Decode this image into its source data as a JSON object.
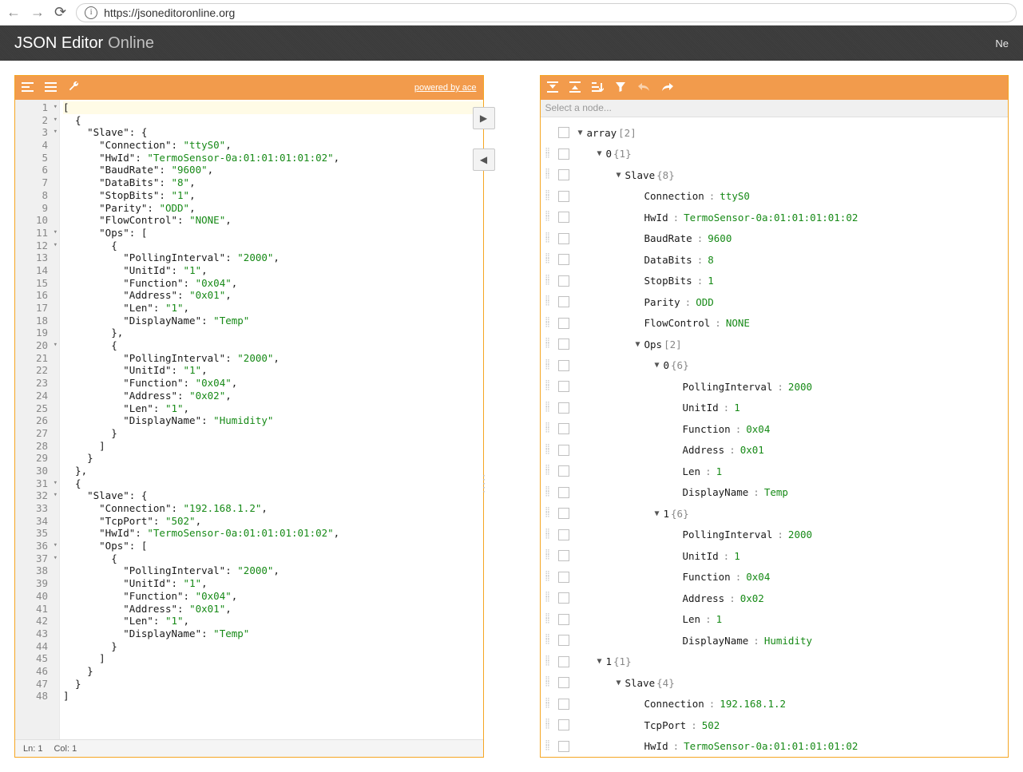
{
  "browser": {
    "url": "https://jsoneditoronline.org",
    "nav_right_label": "Ne"
  },
  "brand": {
    "name": "JSON Editor",
    "suffix": "Online"
  },
  "leftPanel": {
    "powered": "powered by ace",
    "status": {
      "ln": "Ln: 1",
      "col": "Col: 1"
    },
    "gutter": [
      {
        "n": "1",
        "f": true
      },
      {
        "n": "2",
        "f": true
      },
      {
        "n": "3",
        "f": true
      },
      {
        "n": "4"
      },
      {
        "n": "5"
      },
      {
        "n": "6"
      },
      {
        "n": "7"
      },
      {
        "n": "8"
      },
      {
        "n": "9"
      },
      {
        "n": "10"
      },
      {
        "n": "11",
        "f": true
      },
      {
        "n": "12",
        "f": true
      },
      {
        "n": "13"
      },
      {
        "n": "14"
      },
      {
        "n": "15"
      },
      {
        "n": "16"
      },
      {
        "n": "17"
      },
      {
        "n": "18"
      },
      {
        "n": "19"
      },
      {
        "n": "20",
        "f": true
      },
      {
        "n": "21"
      },
      {
        "n": "22"
      },
      {
        "n": "23"
      },
      {
        "n": "24"
      },
      {
        "n": "25"
      },
      {
        "n": "26"
      },
      {
        "n": "27"
      },
      {
        "n": "28"
      },
      {
        "n": "29"
      },
      {
        "n": "30"
      },
      {
        "n": "31",
        "f": true
      },
      {
        "n": "32",
        "f": true
      },
      {
        "n": "33"
      },
      {
        "n": "34"
      },
      {
        "n": "35"
      },
      {
        "n": "36",
        "f": true
      },
      {
        "n": "37",
        "f": true
      },
      {
        "n": "38"
      },
      {
        "n": "39"
      },
      {
        "n": "40"
      },
      {
        "n": "41"
      },
      {
        "n": "42"
      },
      {
        "n": "43"
      },
      {
        "n": "44"
      },
      {
        "n": "45"
      },
      {
        "n": "46"
      },
      {
        "n": "47"
      },
      {
        "n": "48"
      }
    ],
    "code": [
      {
        "hl": true,
        "seg": [
          {
            "t": "[",
            "c": "pun"
          }
        ]
      },
      {
        "seg": [
          {
            "t": "  {",
            "c": "pun"
          }
        ]
      },
      {
        "seg": [
          {
            "t": "    ",
            "c": "pun"
          },
          {
            "t": "\"Slave\"",
            "c": "key"
          },
          {
            "t": ": {",
            "c": "pun"
          }
        ]
      },
      {
        "seg": [
          {
            "t": "      ",
            "c": "pun"
          },
          {
            "t": "\"Connection\"",
            "c": "key"
          },
          {
            "t": ": ",
            "c": "pun"
          },
          {
            "t": "\"ttyS0\"",
            "c": "str"
          },
          {
            "t": ",",
            "c": "pun"
          }
        ]
      },
      {
        "seg": [
          {
            "t": "      ",
            "c": "pun"
          },
          {
            "t": "\"HwId\"",
            "c": "key"
          },
          {
            "t": ": ",
            "c": "pun"
          },
          {
            "t": "\"TermoSensor-0a:01:01:01:01:02\"",
            "c": "str"
          },
          {
            "t": ",",
            "c": "pun"
          }
        ]
      },
      {
        "seg": [
          {
            "t": "      ",
            "c": "pun"
          },
          {
            "t": "\"BaudRate\"",
            "c": "key"
          },
          {
            "t": ": ",
            "c": "pun"
          },
          {
            "t": "\"9600\"",
            "c": "str"
          },
          {
            "t": ",",
            "c": "pun"
          }
        ]
      },
      {
        "seg": [
          {
            "t": "      ",
            "c": "pun"
          },
          {
            "t": "\"DataBits\"",
            "c": "key"
          },
          {
            "t": ": ",
            "c": "pun"
          },
          {
            "t": "\"8\"",
            "c": "str"
          },
          {
            "t": ",",
            "c": "pun"
          }
        ]
      },
      {
        "seg": [
          {
            "t": "      ",
            "c": "pun"
          },
          {
            "t": "\"StopBits\"",
            "c": "key"
          },
          {
            "t": ": ",
            "c": "pun"
          },
          {
            "t": "\"1\"",
            "c": "str"
          },
          {
            "t": ",",
            "c": "pun"
          }
        ]
      },
      {
        "seg": [
          {
            "t": "      ",
            "c": "pun"
          },
          {
            "t": "\"Parity\"",
            "c": "key"
          },
          {
            "t": ": ",
            "c": "pun"
          },
          {
            "t": "\"ODD\"",
            "c": "str"
          },
          {
            "t": ",",
            "c": "pun"
          }
        ]
      },
      {
        "seg": [
          {
            "t": "      ",
            "c": "pun"
          },
          {
            "t": "\"FlowControl\"",
            "c": "key"
          },
          {
            "t": ": ",
            "c": "pun"
          },
          {
            "t": "\"NONE\"",
            "c": "str"
          },
          {
            "t": ",",
            "c": "pun"
          }
        ]
      },
      {
        "seg": [
          {
            "t": "      ",
            "c": "pun"
          },
          {
            "t": "\"Ops\"",
            "c": "key"
          },
          {
            "t": ": [",
            "c": "pun"
          }
        ]
      },
      {
        "seg": [
          {
            "t": "        {",
            "c": "pun"
          }
        ]
      },
      {
        "seg": [
          {
            "t": "          ",
            "c": "pun"
          },
          {
            "t": "\"PollingInterval\"",
            "c": "key"
          },
          {
            "t": ": ",
            "c": "pun"
          },
          {
            "t": "\"2000\"",
            "c": "str"
          },
          {
            "t": ",",
            "c": "pun"
          }
        ]
      },
      {
        "seg": [
          {
            "t": "          ",
            "c": "pun"
          },
          {
            "t": "\"UnitId\"",
            "c": "key"
          },
          {
            "t": ": ",
            "c": "pun"
          },
          {
            "t": "\"1\"",
            "c": "str"
          },
          {
            "t": ",",
            "c": "pun"
          }
        ]
      },
      {
        "seg": [
          {
            "t": "          ",
            "c": "pun"
          },
          {
            "t": "\"Function\"",
            "c": "key"
          },
          {
            "t": ": ",
            "c": "pun"
          },
          {
            "t": "\"0x04\"",
            "c": "str"
          },
          {
            "t": ",",
            "c": "pun"
          }
        ]
      },
      {
        "seg": [
          {
            "t": "          ",
            "c": "pun"
          },
          {
            "t": "\"Address\"",
            "c": "key"
          },
          {
            "t": ": ",
            "c": "pun"
          },
          {
            "t": "\"0x01\"",
            "c": "str"
          },
          {
            "t": ",",
            "c": "pun"
          }
        ]
      },
      {
        "seg": [
          {
            "t": "          ",
            "c": "pun"
          },
          {
            "t": "\"Len\"",
            "c": "key"
          },
          {
            "t": ": ",
            "c": "pun"
          },
          {
            "t": "\"1\"",
            "c": "str"
          },
          {
            "t": ",",
            "c": "pun"
          }
        ]
      },
      {
        "seg": [
          {
            "t": "          ",
            "c": "pun"
          },
          {
            "t": "\"DisplayName\"",
            "c": "key"
          },
          {
            "t": ": ",
            "c": "pun"
          },
          {
            "t": "\"Temp\"",
            "c": "str"
          }
        ]
      },
      {
        "seg": [
          {
            "t": "        },",
            "c": "pun"
          }
        ]
      },
      {
        "seg": [
          {
            "t": "        {",
            "c": "pun"
          }
        ]
      },
      {
        "seg": [
          {
            "t": "          ",
            "c": "pun"
          },
          {
            "t": "\"PollingInterval\"",
            "c": "key"
          },
          {
            "t": ": ",
            "c": "pun"
          },
          {
            "t": "\"2000\"",
            "c": "str"
          },
          {
            "t": ",",
            "c": "pun"
          }
        ]
      },
      {
        "seg": [
          {
            "t": "          ",
            "c": "pun"
          },
          {
            "t": "\"UnitId\"",
            "c": "key"
          },
          {
            "t": ": ",
            "c": "pun"
          },
          {
            "t": "\"1\"",
            "c": "str"
          },
          {
            "t": ",",
            "c": "pun"
          }
        ]
      },
      {
        "seg": [
          {
            "t": "          ",
            "c": "pun"
          },
          {
            "t": "\"Function\"",
            "c": "key"
          },
          {
            "t": ": ",
            "c": "pun"
          },
          {
            "t": "\"0x04\"",
            "c": "str"
          },
          {
            "t": ",",
            "c": "pun"
          }
        ]
      },
      {
        "seg": [
          {
            "t": "          ",
            "c": "pun"
          },
          {
            "t": "\"Address\"",
            "c": "key"
          },
          {
            "t": ": ",
            "c": "pun"
          },
          {
            "t": "\"0x02\"",
            "c": "str"
          },
          {
            "t": ",",
            "c": "pun"
          }
        ]
      },
      {
        "seg": [
          {
            "t": "          ",
            "c": "pun"
          },
          {
            "t": "\"Len\"",
            "c": "key"
          },
          {
            "t": ": ",
            "c": "pun"
          },
          {
            "t": "\"1\"",
            "c": "str"
          },
          {
            "t": ",",
            "c": "pun"
          }
        ]
      },
      {
        "seg": [
          {
            "t": "          ",
            "c": "pun"
          },
          {
            "t": "\"DisplayName\"",
            "c": "key"
          },
          {
            "t": ": ",
            "c": "pun"
          },
          {
            "t": "\"Humidity\"",
            "c": "str"
          }
        ]
      },
      {
        "seg": [
          {
            "t": "        }",
            "c": "pun"
          }
        ]
      },
      {
        "seg": [
          {
            "t": "      ]",
            "c": "pun"
          }
        ]
      },
      {
        "seg": [
          {
            "t": "    }",
            "c": "pun"
          }
        ]
      },
      {
        "seg": [
          {
            "t": "  },",
            "c": "pun"
          }
        ]
      },
      {
        "seg": [
          {
            "t": "  {",
            "c": "pun"
          }
        ]
      },
      {
        "seg": [
          {
            "t": "    ",
            "c": "pun"
          },
          {
            "t": "\"Slave\"",
            "c": "key"
          },
          {
            "t": ": {",
            "c": "pun"
          }
        ]
      },
      {
        "seg": [
          {
            "t": "      ",
            "c": "pun"
          },
          {
            "t": "\"Connection\"",
            "c": "key"
          },
          {
            "t": ": ",
            "c": "pun"
          },
          {
            "t": "\"192.168.1.2\"",
            "c": "str"
          },
          {
            "t": ",",
            "c": "pun"
          }
        ]
      },
      {
        "seg": [
          {
            "t": "      ",
            "c": "pun"
          },
          {
            "t": "\"TcpPort\"",
            "c": "key"
          },
          {
            "t": ": ",
            "c": "pun"
          },
          {
            "t": "\"502\"",
            "c": "str"
          },
          {
            "t": ",",
            "c": "pun"
          }
        ]
      },
      {
        "seg": [
          {
            "t": "      ",
            "c": "pun"
          },
          {
            "t": "\"HwId\"",
            "c": "key"
          },
          {
            "t": ": ",
            "c": "pun"
          },
          {
            "t": "\"TermoSensor-0a:01:01:01:01:02\"",
            "c": "str"
          },
          {
            "t": ",",
            "c": "pun"
          }
        ]
      },
      {
        "seg": [
          {
            "t": "      ",
            "c": "pun"
          },
          {
            "t": "\"Ops\"",
            "c": "key"
          },
          {
            "t": ": [",
            "c": "pun"
          }
        ]
      },
      {
        "seg": [
          {
            "t": "        {",
            "c": "pun"
          }
        ]
      },
      {
        "seg": [
          {
            "t": "          ",
            "c": "pun"
          },
          {
            "t": "\"PollingInterval\"",
            "c": "key"
          },
          {
            "t": ": ",
            "c": "pun"
          },
          {
            "t": "\"2000\"",
            "c": "str"
          },
          {
            "t": ",",
            "c": "pun"
          }
        ]
      },
      {
        "seg": [
          {
            "t": "          ",
            "c": "pun"
          },
          {
            "t": "\"UnitId\"",
            "c": "key"
          },
          {
            "t": ": ",
            "c": "pun"
          },
          {
            "t": "\"1\"",
            "c": "str"
          },
          {
            "t": ",",
            "c": "pun"
          }
        ]
      },
      {
        "seg": [
          {
            "t": "          ",
            "c": "pun"
          },
          {
            "t": "\"Function\"",
            "c": "key"
          },
          {
            "t": ": ",
            "c": "pun"
          },
          {
            "t": "\"0x04\"",
            "c": "str"
          },
          {
            "t": ",",
            "c": "pun"
          }
        ]
      },
      {
        "seg": [
          {
            "t": "          ",
            "c": "pun"
          },
          {
            "t": "\"Address\"",
            "c": "key"
          },
          {
            "t": ": ",
            "c": "pun"
          },
          {
            "t": "\"0x01\"",
            "c": "str"
          },
          {
            "t": ",",
            "c": "pun"
          }
        ]
      },
      {
        "seg": [
          {
            "t": "          ",
            "c": "pun"
          },
          {
            "t": "\"Len\"",
            "c": "key"
          },
          {
            "t": ": ",
            "c": "pun"
          },
          {
            "t": "\"1\"",
            "c": "str"
          },
          {
            "t": ",",
            "c": "pun"
          }
        ]
      },
      {
        "seg": [
          {
            "t": "          ",
            "c": "pun"
          },
          {
            "t": "\"DisplayName\"",
            "c": "key"
          },
          {
            "t": ": ",
            "c": "pun"
          },
          {
            "t": "\"Temp\"",
            "c": "str"
          }
        ]
      },
      {
        "seg": [
          {
            "t": "        }",
            "c": "pun"
          }
        ]
      },
      {
        "seg": [
          {
            "t": "      ]",
            "c": "pun"
          }
        ]
      },
      {
        "seg": [
          {
            "t": "    }",
            "c": "pun"
          }
        ]
      },
      {
        "seg": [
          {
            "t": "  }",
            "c": "pun"
          }
        ]
      },
      {
        "seg": [
          {
            "t": "]",
            "c": "pun"
          }
        ]
      }
    ]
  },
  "rightPanel": {
    "placeholder": "Select a node...",
    "rows": [
      {
        "d": 0,
        "caret": "▼",
        "key": "array",
        "info": "[2]",
        "noHandle": true
      },
      {
        "d": 1,
        "caret": "▼",
        "key": "0",
        "info": "{1}"
      },
      {
        "d": 2,
        "caret": "▼",
        "key": "Slave",
        "info": "{8}"
      },
      {
        "d": 3,
        "caret": "",
        "key": "Connection",
        "val": "ttyS0"
      },
      {
        "d": 3,
        "caret": "",
        "key": "HwId",
        "val": "TermoSensor-0a:01:01:01:01:02"
      },
      {
        "d": 3,
        "caret": "",
        "key": "BaudRate",
        "val": "9600"
      },
      {
        "d": 3,
        "caret": "",
        "key": "DataBits",
        "val": "8"
      },
      {
        "d": 3,
        "caret": "",
        "key": "StopBits",
        "val": "1"
      },
      {
        "d": 3,
        "caret": "",
        "key": "Parity",
        "val": "ODD"
      },
      {
        "d": 3,
        "caret": "",
        "key": "FlowControl",
        "val": "NONE"
      },
      {
        "d": 3,
        "caret": "▼",
        "key": "Ops",
        "info": "[2]"
      },
      {
        "d": 4,
        "caret": "▼",
        "key": "0",
        "info": "{6}"
      },
      {
        "d": 5,
        "caret": "",
        "key": "PollingInterval",
        "val": "2000"
      },
      {
        "d": 5,
        "caret": "",
        "key": "UnitId",
        "val": "1"
      },
      {
        "d": 5,
        "caret": "",
        "key": "Function",
        "val": "0x04"
      },
      {
        "d": 5,
        "caret": "",
        "key": "Address",
        "val": "0x01"
      },
      {
        "d": 5,
        "caret": "",
        "key": "Len",
        "val": "1"
      },
      {
        "d": 5,
        "caret": "",
        "key": "DisplayName",
        "val": "Temp"
      },
      {
        "d": 4,
        "caret": "▼",
        "key": "1",
        "info": "{6}"
      },
      {
        "d": 5,
        "caret": "",
        "key": "PollingInterval",
        "val": "2000"
      },
      {
        "d": 5,
        "caret": "",
        "key": "UnitId",
        "val": "1"
      },
      {
        "d": 5,
        "caret": "",
        "key": "Function",
        "val": "0x04"
      },
      {
        "d": 5,
        "caret": "",
        "key": "Address",
        "val": "0x02"
      },
      {
        "d": 5,
        "caret": "",
        "key": "Len",
        "val": "1"
      },
      {
        "d": 5,
        "caret": "",
        "key": "DisplayName",
        "val": "Humidity"
      },
      {
        "d": 1,
        "caret": "▼",
        "key": "1",
        "info": "{1}"
      },
      {
        "d": 2,
        "caret": "▼",
        "key": "Slave",
        "info": "{4}"
      },
      {
        "d": 3,
        "caret": "",
        "key": "Connection",
        "val": "192.168.1.2"
      },
      {
        "d": 3,
        "caret": "",
        "key": "TcpPort",
        "val": "502"
      },
      {
        "d": 3,
        "caret": "",
        "key": "HwId",
        "val": "TermoSensor-0a:01:01:01:01:02"
      }
    ]
  }
}
